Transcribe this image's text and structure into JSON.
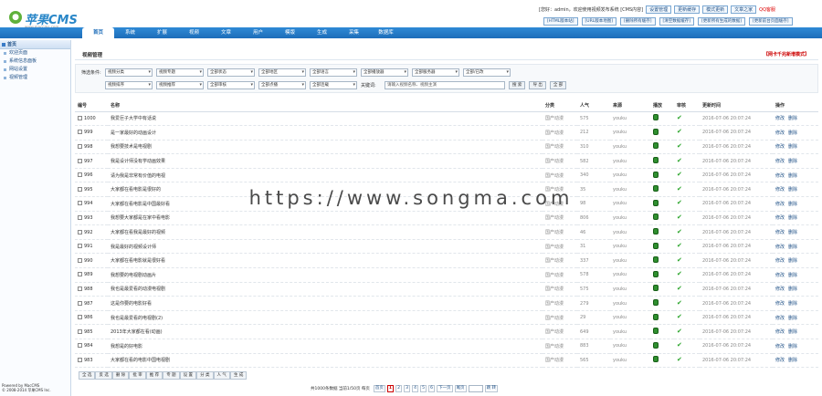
{
  "logo": {
    "name": "苹果CMS",
    "sub": "www.maccms.com"
  },
  "topbar": {
    "user": "[您好：admin，欢迎使用视频发布系统 [CMS内容]",
    "buttons": [
      "设置管理",
      "更新缓存",
      "模式更新",
      "文章之家"
    ],
    "qq": "QQ客服"
  },
  "toprow2": [
    "[HTML版本站]",
    "[URL版本地图]",
    "[删除所有缓存]",
    "[清空数据缓存]",
    "[更新所有生成的数据]",
    "[更新前台页面缓存]"
  ],
  "nav": [
    "首页",
    "系统",
    "扩展",
    "视频",
    "文章",
    "用户",
    "模版",
    "生成",
    "采集",
    "数据库"
  ],
  "sidebar": {
    "head": "首页",
    "items": [
      "欢迎页面",
      "系统信息面板",
      "网站设置",
      "视频管理"
    ]
  },
  "footer": [
    "Powered by MacCMS",
    "© 2008-2014 苹果CMS Inc."
  ],
  "panel": {
    "title": "视频管理",
    "link": "【网卡千兆新增模式】"
  },
  "filter": {
    "label1": "筛选条件:",
    "row1": [
      "视频分类",
      "视频专题",
      "全部状态",
      "全部地区",
      "全部语言",
      "全部播放器",
      "全部服务器",
      "全部/已改"
    ],
    "row2": [
      "视频排序",
      "视频推荐",
      "全部审核",
      "全部点播",
      "全部连载"
    ],
    "keyword_label": "关键词:",
    "keyword_placeholder": "请输入视频名称、视频主演",
    "buttons": [
      "搜 索",
      "导 出",
      "全 部"
    ]
  },
  "table": {
    "headers": [
      "编号",
      "名称",
      "分类",
      "人气",
      "来源",
      "播放",
      "审核",
      "更新时间",
      "操作"
    ],
    "rows": [
      {
        "id": "1000",
        "name": "我爱巨子大学中有话说",
        "cat": "国产动漫",
        "hits": "575",
        "src": "youku",
        "time": "2016-07-06 20:07:24"
      },
      {
        "id": "999",
        "name": "是一家最好的动画设计",
        "cat": "国产动漫",
        "hits": "212",
        "src": "youku",
        "time": "2016-07-06 20:07:24"
      },
      {
        "id": "998",
        "name": "我想要技术是电视剧",
        "cat": "国产动漫",
        "hits": "310",
        "src": "youku",
        "time": "2016-07-06 20:07:24"
      },
      {
        "id": "997",
        "name": "我是设计师没有学动画效果",
        "cat": "国产动漫",
        "hits": "582",
        "src": "youku",
        "time": "2016-07-06 20:07:24"
      },
      {
        "id": "996",
        "name": "请为我是非常有价值的电视",
        "cat": "国产动漫",
        "hits": "340",
        "src": "youku",
        "time": "2016-07-06 20:07:24"
      },
      {
        "id": "995",
        "name": "大家都在看电影是很好的",
        "cat": "国产动漫",
        "hits": "35",
        "src": "youku",
        "time": "2016-07-06 20:07:24"
      },
      {
        "id": "994",
        "name": "大家都在看电影是中国最好看",
        "cat": "国产动漫",
        "hits": "98",
        "src": "youku",
        "time": "2016-07-06 20:07:24"
      },
      {
        "id": "993",
        "name": "我想要大家都是在家中看电影",
        "cat": "国产动漫",
        "hits": "806",
        "src": "youku",
        "time": "2016-07-06 20:07:24"
      },
      {
        "id": "992",
        "name": "大家都在看我是最好的视频",
        "cat": "国产动漫",
        "hits": "46",
        "src": "youku",
        "time": "2016-07-06 20:07:24"
      },
      {
        "id": "991",
        "name": "我是最好的视频设计师",
        "cat": "国产动漫",
        "hits": "31",
        "src": "youku",
        "time": "2016-07-06 20:07:24"
      },
      {
        "id": "990",
        "name": "大家都在看电影就是很好看",
        "cat": "国产动漫",
        "hits": "337",
        "src": "youku",
        "time": "2016-07-06 20:07:24"
      },
      {
        "id": "989",
        "name": "我想要的电视剧动画片",
        "cat": "国产动漫",
        "hits": "578",
        "src": "youku",
        "time": "2016-07-06 20:07:24"
      },
      {
        "id": "988",
        "name": "我也是最爱看的动漫电视剧",
        "cat": "国产动漫",
        "hits": "575",
        "src": "youku",
        "time": "2016-07-06 20:07:24"
      },
      {
        "id": "987",
        "name": "这是你要的电影好看",
        "cat": "国产动漫",
        "hits": "279",
        "src": "youku",
        "time": "2016-07-06 20:07:24"
      },
      {
        "id": "986",
        "name": "我也是最爱看的电视剧(2)",
        "cat": "国产动漫",
        "hits": "29",
        "src": "youku",
        "time": "2016-07-06 20:07:24"
      },
      {
        "id": "985",
        "name": "2013年大家都在看(动画)",
        "cat": "国产动漫",
        "hits": "649",
        "src": "youku",
        "time": "2016-07-06 20:07:24"
      },
      {
        "id": "984",
        "name": "我想是的好电影",
        "cat": "国产动漫",
        "hits": "883",
        "src": "youku",
        "time": "2016-07-06 20:07:24"
      },
      {
        "id": "983",
        "name": "大家都在看的电影中国电视剧",
        "cat": "国产动漫",
        "hits": "565",
        "src": "youku",
        "time": "2016-07-06 20:07:24"
      }
    ],
    "actions": [
      "修改",
      "删除"
    ]
  },
  "bulk": [
    "全 选",
    "反 选",
    "删 除",
    "批 审",
    "推 荐",
    "专 题",
    "设 置",
    "分 类",
    "人 气",
    "生 成"
  ],
  "pager": {
    "info": "共1000条数据 当前1/50页 每页",
    "pages": [
      "首页",
      "1",
      "2",
      "3",
      "4",
      "5",
      "6",
      "下一页",
      "尾页"
    ],
    "go": "跳 转"
  },
  "watermark": "https://www.songma.com"
}
